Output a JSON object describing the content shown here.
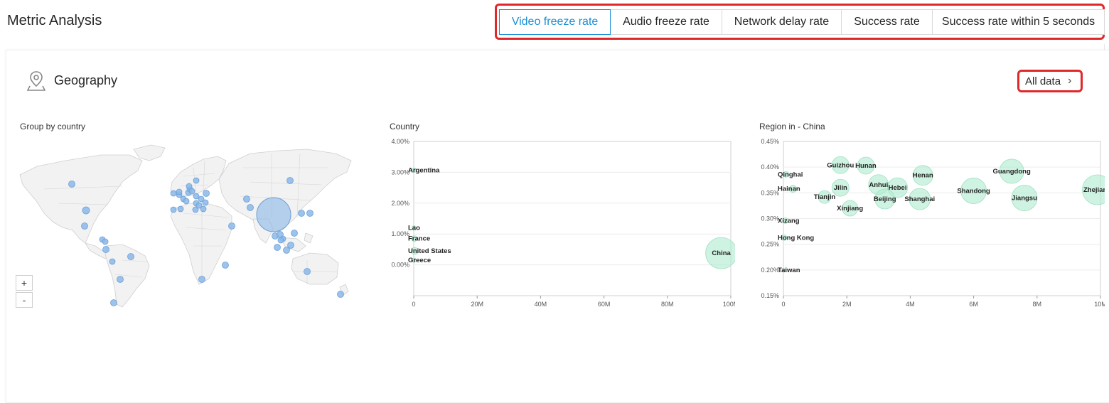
{
  "header": {
    "title": "Metric Analysis",
    "tabs": [
      "Video freeze rate",
      "Audio freeze rate",
      "Network delay rate",
      "Success rate",
      "Success rate within 5 seconds"
    ],
    "active_tab": 0
  },
  "geography": {
    "title": "Geography",
    "all_data_label": "All data",
    "map_label": "Group by country",
    "zoom_in": "+",
    "zoom_out": "-"
  },
  "colors": {
    "accent": "#1a8fd6",
    "highlight": "#e0282a",
    "map_marker": "#8ab8e8",
    "bubble": "#b5ecd3"
  },
  "chart_data": [
    {
      "type": "scatter",
      "title": "Country",
      "ylim": [
        -0.01,
        0.04
      ],
      "xlim": [
        -0.001,
        100000000
      ],
      "yticks": [
        0.0,
        0.01,
        0.02,
        0.03,
        0.04
      ],
      "ytick_labels": [
        "0.00%",
        "1.00%",
        "2.00%",
        "3.00%",
        "4.00%"
      ],
      "xticks": [
        0,
        20000000,
        40000000,
        60000000,
        80000000,
        100000000
      ],
      "xtick_labels": [
        "0",
        "20M",
        "40M",
        "60M",
        "80M",
        "100M"
      ],
      "grid": true,
      "points": [
        {
          "label": "Argentina",
          "x": 120000,
          "y": 0.0307,
          "size": 3
        },
        {
          "label": "Lao",
          "x": 60000,
          "y": 0.012,
          "size": 3
        },
        {
          "label": "France",
          "x": 150000,
          "y": 0.0085,
          "size": 4
        },
        {
          "label": "United States",
          "x": 300000,
          "y": 0.0045,
          "size": 5
        },
        {
          "label": "Greece",
          "x": 100000,
          "y": 0.0015,
          "size": 3
        },
        {
          "label": "China",
          "x": 97000000,
          "y": 0.0038,
          "size": 22
        }
      ]
    },
    {
      "type": "scatter",
      "title": "Region in - China",
      "ylim": [
        0.0015,
        0.0045
      ],
      "xlim": [
        -0.001,
        10000000
      ],
      "yticks": [
        0.0015,
        0.002,
        0.0025,
        0.003,
        0.0035,
        0.004,
        0.0045
      ],
      "ytick_labels": [
        "0.15%",
        "0.20%",
        "0.25%",
        "0.30%",
        "0.35%",
        "0.40%",
        "0.45%"
      ],
      "xticks": [
        0,
        2000000,
        4000000,
        6000000,
        8000000,
        10000000
      ],
      "xtick_labels": [
        "0",
        "2M",
        "4M",
        "6M",
        "8M",
        "10M"
      ],
      "grid": true,
      "points": [
        {
          "label": "Guizhou",
          "x": 1800000,
          "y": 0.00404,
          "size": 12
        },
        {
          "label": "Hunan",
          "x": 2600000,
          "y": 0.00403,
          "size": 12
        },
        {
          "label": "Qinghai",
          "x": 80000,
          "y": 0.00386,
          "size": 4
        },
        {
          "label": "Henan",
          "x": 4400000,
          "y": 0.00384,
          "size": 14
        },
        {
          "label": "Guangdong",
          "x": 7200000,
          "y": 0.00392,
          "size": 17
        },
        {
          "label": "Hainan",
          "x": 300000,
          "y": 0.00358,
          "size": 5
        },
        {
          "label": "Jilin",
          "x": 1800000,
          "y": 0.0036,
          "size": 12
        },
        {
          "label": "Anhui",
          "x": 3000000,
          "y": 0.00366,
          "size": 14
        },
        {
          "label": "Hebei",
          "x": 3600000,
          "y": 0.0036,
          "size": 14
        },
        {
          "label": "Shandong",
          "x": 6000000,
          "y": 0.00354,
          "size": 18
        },
        {
          "label": "Zhejiang",
          "x": 9900000,
          "y": 0.00356,
          "size": 21
        },
        {
          "label": "Tianjin",
          "x": 1300000,
          "y": 0.00342,
          "size": 9
        },
        {
          "label": "Beijing",
          "x": 3200000,
          "y": 0.00338,
          "size": 14
        },
        {
          "label": "Shanghai",
          "x": 4300000,
          "y": 0.00338,
          "size": 15
        },
        {
          "label": "Jiangsu",
          "x": 7600000,
          "y": 0.0034,
          "size": 18
        },
        {
          "label": "Xinjiang",
          "x": 2100000,
          "y": 0.0032,
          "size": 11
        },
        {
          "label": "Xizang",
          "x": 60000,
          "y": 0.00296,
          "size": 4
        },
        {
          "label": "Hong Kong",
          "x": 20000,
          "y": 0.00263,
          "size": 4
        },
        {
          "label": "Taiwan",
          "x": 10000,
          "y": 0.002,
          "size": 2
        }
      ]
    }
  ]
}
